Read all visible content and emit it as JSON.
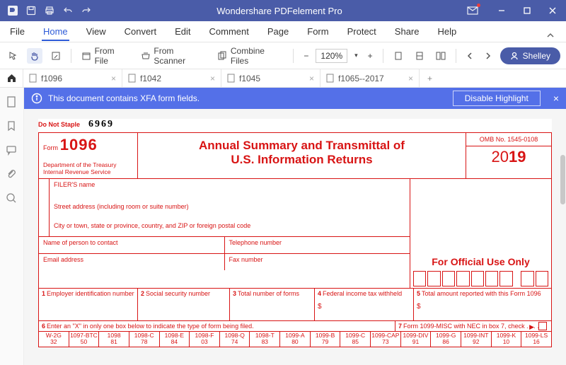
{
  "app": {
    "title": "Wondershare PDFelement Pro"
  },
  "menu": [
    "File",
    "Home",
    "View",
    "Convert",
    "Edit",
    "Comment",
    "Page",
    "Form",
    "Protect",
    "Share",
    "Help"
  ],
  "menuActive": 1,
  "toolbar": {
    "fromFile": "From File",
    "fromScanner": "From Scanner",
    "combine": "Combine Files",
    "zoom": "120%",
    "user": "Shelley"
  },
  "tabs": [
    {
      "name": "f1096"
    },
    {
      "name": "f1042"
    },
    {
      "name": "f1045"
    },
    {
      "name": "f1065--2017"
    }
  ],
  "xfa": {
    "msg": "This document contains XFA form fields.",
    "btn": "Disable Highlight"
  },
  "form": {
    "doNotStaple": "Do Not Staple",
    "stapleNum": "6969",
    "formWord": "Form",
    "formNum": "1096",
    "dept": "Department of the Treasury\nInternal Revenue Service",
    "title1": "Annual Summary and Transmittal of",
    "title2": "U.S. Information Returns",
    "omb": "OMB No. 1545-0108",
    "yearThin": "20",
    "yearBold": "19",
    "filerName": "FILER'S name",
    "street": "Street address (including room or suite number)",
    "city": "City or town, state or province, country, and ZIP or foreign postal code",
    "contact": "Name of person to contact",
    "phone": "Telephone number",
    "email": "Email address",
    "fax": "Fax number",
    "official": "For Official Use Only",
    "f1": "Employer identification number",
    "f2": "Social security number",
    "f3": "Total number of forms",
    "f4": "Federal income tax withheld",
    "f5": "Total amount reported with this Form 1096",
    "f6": "Enter an \"X\" in only one box below to indicate the type of form being filed.",
    "f7": "Form 1099-MISC with NEC in box 7, check  .   .   .   .",
    "cols": [
      {
        "a": "W-2G",
        "b": "32"
      },
      {
        "a": "1097-BTC",
        "b": "50"
      },
      {
        "a": "1098",
        "b": "81"
      },
      {
        "a": "1098-C",
        "b": "78"
      },
      {
        "a": "1098-E",
        "b": "84"
      },
      {
        "a": "1098-F",
        "b": "03"
      },
      {
        "a": "1098-Q",
        "b": "74"
      },
      {
        "a": "1098-T",
        "b": "83"
      },
      {
        "a": "1099-A",
        "b": "80"
      },
      {
        "a": "1099-B",
        "b": "79"
      },
      {
        "a": "1099-C",
        "b": "85"
      },
      {
        "a": "1099-CAP",
        "b": "73"
      },
      {
        "a": "1099-DIV",
        "b": "91"
      },
      {
        "a": "1099-G",
        "b": "86"
      },
      {
        "a": "1099-INT",
        "b": "92"
      },
      {
        "a": "1099-K",
        "b": "10"
      },
      {
        "a": "1099-LS",
        "b": "16"
      }
    ]
  }
}
